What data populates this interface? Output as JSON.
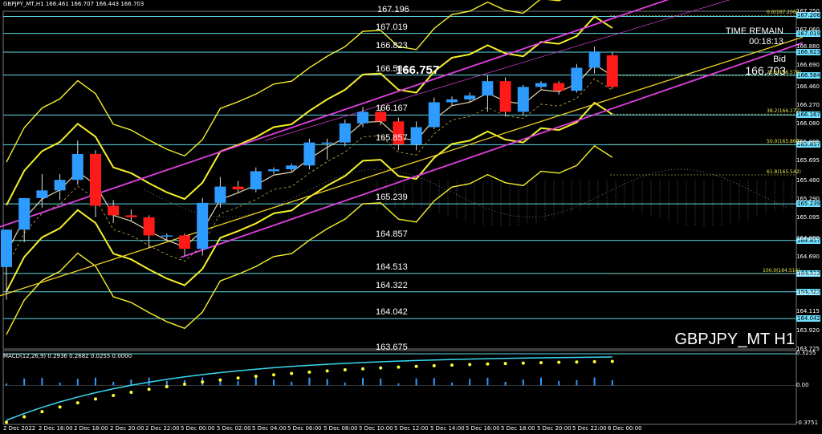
{
  "header": {
    "title": "GBPJPY_MT,H1  166.461 166.707 166.443 166.703"
  },
  "macd_header": "MACD(12,26,9) 0.2936 0.2682 0.0255 0.0000",
  "symbol_label": "GBPJPY_MT H1",
  "time_remain": {
    "label": "TIME REMAIN",
    "value": "00:18:13"
  },
  "bid": {
    "label": "Bid",
    "value": "166.703"
  },
  "big_bid": "166.757",
  "level_labels": [
    "167.196",
    "167.019",
    "166.823",
    "166.584",
    "166.167",
    "165.857",
    "165.239",
    "164.857",
    "164.513",
    "164.322",
    "164.042",
    "163.675"
  ],
  "y_axis": [
    "167.250",
    "167.060",
    "166.880",
    "166.690",
    "166.460",
    "166.270",
    "166.080",
    "165.885",
    "165.695",
    "165.480",
    "165.290",
    "165.095",
    "164.880",
    "164.690",
    "164.500",
    "164.305",
    "164.115",
    "163.920",
    "163.725"
  ],
  "y_tags": [
    "167.206",
    "167.019",
    "166.823",
    "166.584",
    "166.167",
    "165.857",
    "165.239",
    "164.857",
    "164.513",
    "164.322",
    "164.042"
  ],
  "macd_axis": [
    "0.3255",
    "0.00",
    "-0.3751"
  ],
  "fibo": [
    "0.0(167.206)",
    "23.6(166.576)",
    "38.2(166.177)",
    "50.0(165.860)",
    "61.8(165.542)",
    "100.0(164.514)"
  ],
  "x_axis": [
    "2 Dec 2022",
    "2 Dec 16:00",
    "2 Dec 18:00",
    "2 Dec 20:00",
    "2 Dec 22:00",
    "5 Dec 00:00",
    "5 Dec 02:00",
    "5 Dec 04:00",
    "5 Dec 06:00",
    "5 Dec 08:00",
    "5 Dec 10:00",
    "5 Dec 12:00",
    "5 Dec 14:00",
    "5 Dec 16:00",
    "5 Dec 18:00",
    "5 Dec 20:00",
    "5 Dec 22:00",
    "6 Dec 00:00"
  ],
  "colors": {
    "bull": "#2e9bff",
    "bear": "#ff1a1a",
    "level": "#5fd8e8",
    "band": "#f5f02a",
    "channel": "#e040e0",
    "macd_line": "#3ad8f0",
    "signal": "#ffff33"
  },
  "chart_data": {
    "type": "candlestick",
    "candles": [
      {
        "o": 164.58,
        "h": 164.97,
        "l": 164.24,
        "c": 164.97
      },
      {
        "o": 164.97,
        "h": 165.3,
        "l": 164.84,
        "c": 165.3
      },
      {
        "o": 165.3,
        "h": 165.55,
        "l": 165.2,
        "c": 165.38
      },
      {
        "o": 165.38,
        "h": 165.55,
        "l": 165.28,
        "c": 165.49
      },
      {
        "o": 165.49,
        "h": 165.9,
        "l": 165.44,
        "c": 165.76
      },
      {
        "o": 165.76,
        "h": 165.8,
        "l": 165.1,
        "c": 165.22
      },
      {
        "o": 165.22,
        "h": 165.28,
        "l": 165.04,
        "c": 165.12
      },
      {
        "o": 165.12,
        "h": 165.18,
        "l": 165.06,
        "c": 165.1
      },
      {
        "o": 165.1,
        "h": 165.12,
        "l": 164.78,
        "c": 164.91
      },
      {
        "o": 164.91,
        "h": 164.93,
        "l": 164.85,
        "c": 164.91
      },
      {
        "o": 164.91,
        "h": 164.93,
        "l": 164.7,
        "c": 164.77
      },
      {
        "o": 164.77,
        "h": 165.3,
        "l": 164.7,
        "c": 165.25
      },
      {
        "o": 165.25,
        "h": 165.52,
        "l": 165.2,
        "c": 165.42
      },
      {
        "o": 165.42,
        "h": 165.48,
        "l": 165.36,
        "c": 165.39
      },
      {
        "o": 165.39,
        "h": 165.62,
        "l": 165.36,
        "c": 165.58
      },
      {
        "o": 165.58,
        "h": 165.62,
        "l": 165.55,
        "c": 165.6
      },
      {
        "o": 165.6,
        "h": 165.66,
        "l": 165.58,
        "c": 165.64
      },
      {
        "o": 165.64,
        "h": 165.92,
        "l": 165.6,
        "c": 165.88
      },
      {
        "o": 165.88,
        "h": 165.92,
        "l": 165.7,
        "c": 165.88
      },
      {
        "o": 165.88,
        "h": 166.12,
        "l": 165.84,
        "c": 166.08
      },
      {
        "o": 166.08,
        "h": 166.25,
        "l": 166.04,
        "c": 166.2
      },
      {
        "o": 166.2,
        "h": 166.24,
        "l": 166.06,
        "c": 166.1
      },
      {
        "o": 166.1,
        "h": 166.14,
        "l": 165.8,
        "c": 165.86
      },
      {
        "o": 165.86,
        "h": 166.1,
        "l": 165.8,
        "c": 166.04
      },
      {
        "o": 166.04,
        "h": 166.35,
        "l": 166.02,
        "c": 166.3
      },
      {
        "o": 166.3,
        "h": 166.36,
        "l": 166.27,
        "c": 166.33
      },
      {
        "o": 166.33,
        "h": 166.4,
        "l": 166.3,
        "c": 166.37
      },
      {
        "o": 166.37,
        "h": 166.58,
        "l": 166.2,
        "c": 166.52
      },
      {
        "o": 166.52,
        "h": 166.56,
        "l": 166.15,
        "c": 166.2
      },
      {
        "o": 166.2,
        "h": 166.48,
        "l": 166.16,
        "c": 166.46
      },
      {
        "o": 166.46,
        "h": 166.52,
        "l": 166.44,
        "c": 166.5
      },
      {
        "o": 166.5,
        "h": 166.52,
        "l": 166.38,
        "c": 166.42
      },
      {
        "o": 166.42,
        "h": 166.7,
        "l": 166.4,
        "c": 166.66
      },
      {
        "o": 166.66,
        "h": 166.88,
        "l": 166.6,
        "c": 166.83
      },
      {
        "o": 166.79,
        "h": 166.82,
        "l": 166.44,
        "c": 166.46
      }
    ],
    "ylim": [
      163.725,
      167.25
    ]
  }
}
